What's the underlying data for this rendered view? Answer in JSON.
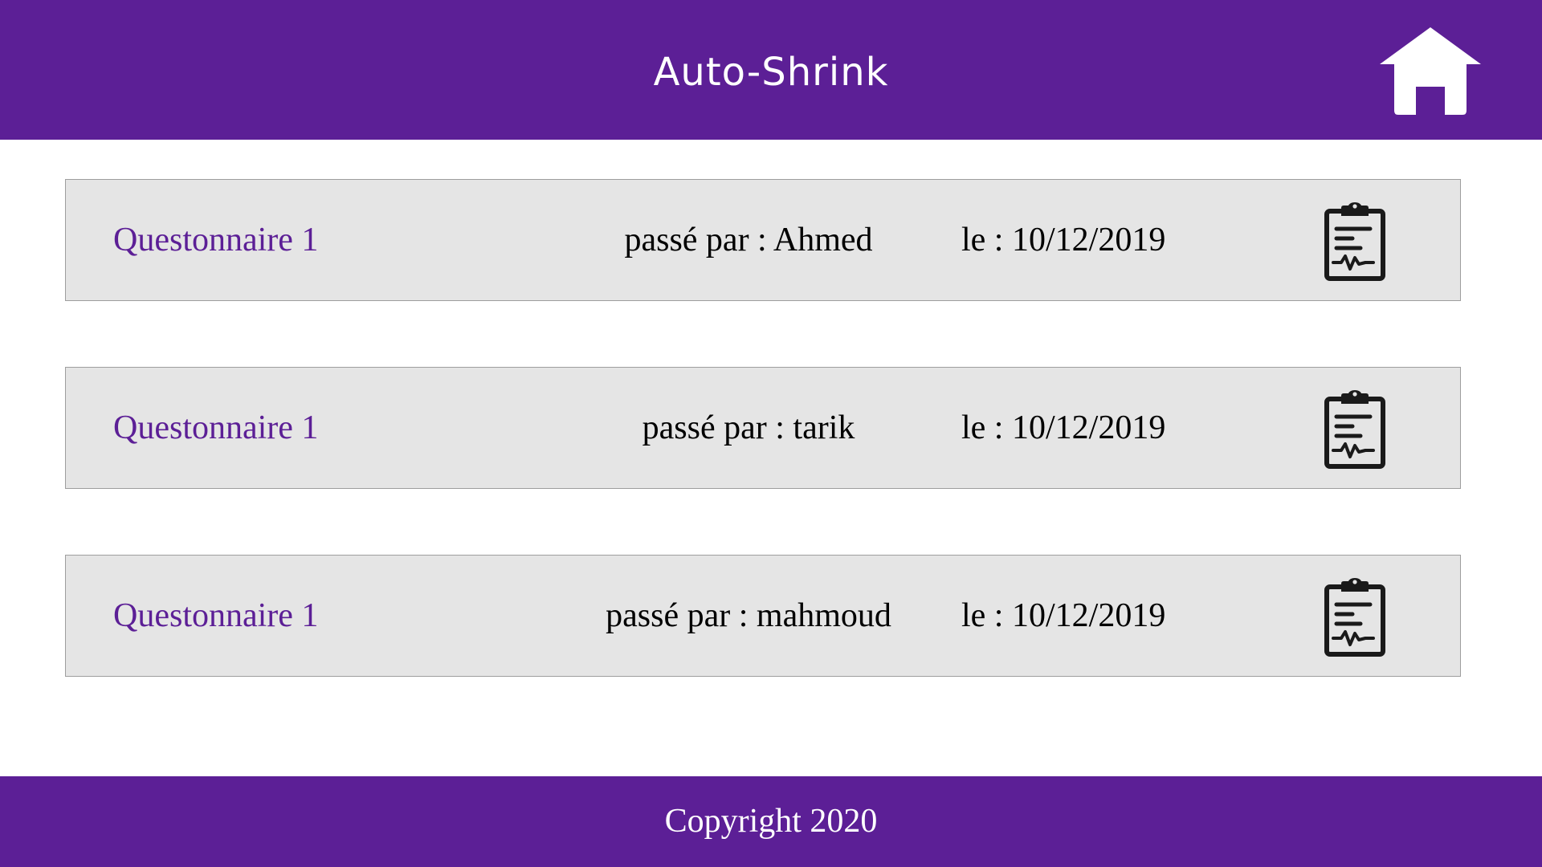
{
  "header": {
    "title": "Auto-Shrink",
    "home_icon": "home-icon"
  },
  "theme": {
    "primary": "#5c1f96",
    "row_background": "#e5e5e5",
    "text": "#000000"
  },
  "questionnaires": [
    {
      "title": "Questonnaire 1",
      "taken_by": "passé par : Ahmed",
      "date": "le : 10/12/2019",
      "icon": "clipboard-report-icon"
    },
    {
      "title": "Questonnaire 1",
      "taken_by": "passé par : tarik",
      "date": "le : 10/12/2019",
      "icon": "clipboard-report-icon"
    },
    {
      "title": "Questonnaire 1",
      "taken_by": "passé par : mahmoud",
      "date": "le : 10/12/2019",
      "icon": "clipboard-report-icon"
    }
  ],
  "footer": {
    "text": "Copyright 2020"
  }
}
